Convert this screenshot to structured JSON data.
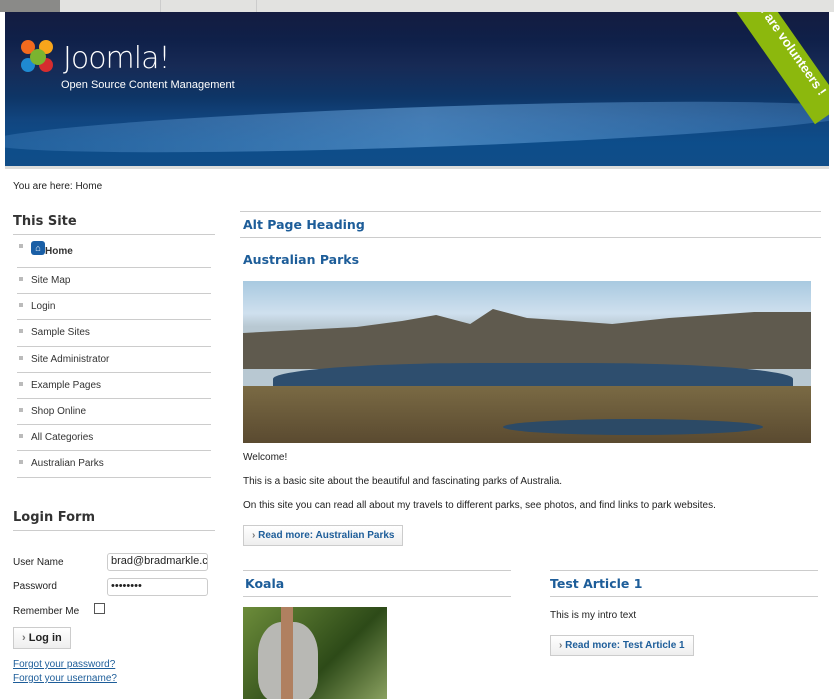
{
  "header": {
    "logo_text": "Joomla!",
    "tagline": "Open Source Content Management",
    "ribbon": "We are volunteers !"
  },
  "breadcrumb": "You are here: Home",
  "sidebar": {
    "title": "This Site",
    "items": [
      {
        "label": "Home"
      },
      {
        "label": "Site Map"
      },
      {
        "label": "Login"
      },
      {
        "label": "Sample Sites"
      },
      {
        "label": "Site Administrator"
      },
      {
        "label": "Example Pages"
      },
      {
        "label": "Shop Online"
      },
      {
        "label": "All Categories"
      },
      {
        "label": "Australian Parks"
      }
    ]
  },
  "login": {
    "title": "Login Form",
    "username_label": "User Name",
    "username_value": "brad@bradmarkle.com",
    "password_label": "Password",
    "password_value": "••••••••",
    "remember_label": "Remember Me",
    "login_button": "Log in",
    "forgot_password": "Forgot your password?",
    "forgot_username": "Forgot your username?"
  },
  "main": {
    "page_heading": "Alt Page Heading",
    "article_title": "Australian Parks",
    "p1": "Welcome!",
    "p2": "This is a basic site about the beautiful and fascinating parks of Australia.",
    "p3": "On this site you can read all about my travels to different parks, see photos, and find links to park websites.",
    "read_more": "Read more: Australian Parks",
    "koala": {
      "title": "Koala"
    },
    "test": {
      "title": "Test Article 1",
      "intro": "This is my intro text",
      "read_more": "Read more: Test Article 1"
    }
  }
}
